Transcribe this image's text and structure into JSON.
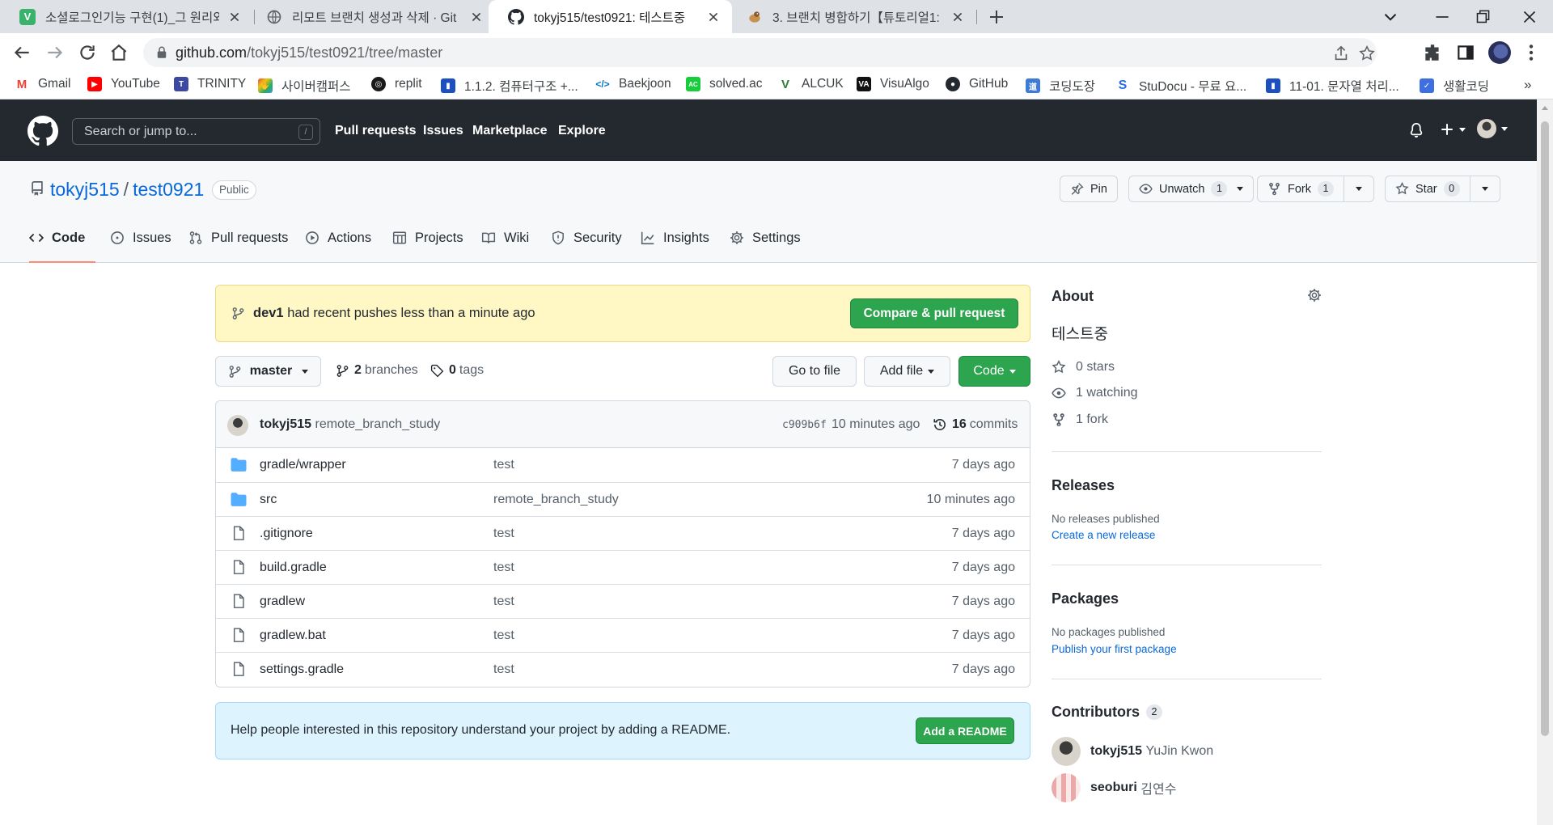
{
  "browser": {
    "tabs": [
      {
        "title": "소셜로그인기능 구현(1)_그 원리와",
        "favicon": "v-icon"
      },
      {
        "title": "리모트 브랜치 생성과 삭제 · Git",
        "favicon": "globe-icon"
      },
      {
        "title": "tokyj515/test0921: 테스트중",
        "favicon": "github-icon"
      },
      {
        "title": "3. 브랜치 병합하기【튜토리얼1:",
        "favicon": "bird-icon"
      }
    ],
    "url": {
      "host": "github.com",
      "path": "/tokyj515/test0921/tree/master"
    },
    "bookmarks": [
      {
        "label": "Gmail",
        "icon": "gmail-icon",
        "color": "#ea4335"
      },
      {
        "label": "YouTube",
        "icon": "youtube-icon",
        "color": "#ff0000"
      },
      {
        "label": "TRINITY",
        "icon": "trinity-icon",
        "color": "#3b4aa0"
      },
      {
        "label": "사이버캠퍼스",
        "icon": "hand-icon",
        "color": "#8e44ad"
      },
      {
        "label": "replit",
        "icon": "replit-icon",
        "color": "#1a1a1a"
      },
      {
        "label": "1.1.2. 컴퓨터구조 +...",
        "icon": "book-icon",
        "color": "#1c4fbf"
      },
      {
        "label": "Baekjoon",
        "icon": "code-icon",
        "color": "#0076c0"
      },
      {
        "label": "solved.ac",
        "icon": "solvedac-icon",
        "color": "#17ce3a"
      },
      {
        "label": "ALCUK",
        "icon": "alcuk-icon",
        "color": "#2e7d32"
      },
      {
        "label": "VisuAlgo",
        "icon": "visualgo-icon",
        "color": "#111111"
      },
      {
        "label": "GitHub",
        "icon": "github-icon",
        "color": "#24292f"
      },
      {
        "label": "코딩도장",
        "icon": "dojang-icon",
        "color": "#3f7bd6"
      },
      {
        "label": "StuDocu - 무료 요...",
        "icon": "studocu-icon",
        "color": "#2b6be6"
      },
      {
        "label": "11-01. 문자열 처리...",
        "icon": "book-icon",
        "color": "#1c4fbf"
      },
      {
        "label": "생활코딩",
        "icon": "shield-icon",
        "color": "#3d6fe0"
      }
    ],
    "bookmarks_more": "»"
  },
  "gh": {
    "search_placeholder": "Search or jump to...",
    "search_key": "/",
    "nav": [
      "Pull requests",
      "Issues",
      "Marketplace",
      "Explore"
    ]
  },
  "repo": {
    "owner": "tokyj515",
    "slash": "/",
    "name": "test0921",
    "visibility": "Public",
    "pin": "Pin",
    "unwatch": "Unwatch",
    "watch_count": "1",
    "fork": "Fork",
    "fork_count": "1",
    "star": "Star",
    "star_count": "0",
    "tabs": [
      {
        "label": "Code",
        "icon": "code-icon",
        "selected": true
      },
      {
        "label": "Issues",
        "icon": "issue-icon"
      },
      {
        "label": "Pull requests",
        "icon": "pull-request-icon"
      },
      {
        "label": "Actions",
        "icon": "play-icon"
      },
      {
        "label": "Projects",
        "icon": "table-icon"
      },
      {
        "label": "Wiki",
        "icon": "book-icon"
      },
      {
        "label": "Security",
        "icon": "shield-icon"
      },
      {
        "label": "Insights",
        "icon": "graph-icon"
      },
      {
        "label": "Settings",
        "icon": "gear-icon"
      }
    ]
  },
  "banner": {
    "branch": "dev1",
    "text": "had recent pushes less than a minute ago",
    "button": "Compare & pull request"
  },
  "bar": {
    "branch": "master",
    "branches_count": "2",
    "branches_label": "branches",
    "tags_count": "0",
    "tags_label": "tags",
    "go_to_file": "Go to file",
    "add_file": "Add file",
    "code": "Code"
  },
  "commit": {
    "author": "tokyj515",
    "message": "remote_branch_study",
    "sha": "c909b6f",
    "time": "10 minutes ago",
    "count": "16",
    "count_label": "commits"
  },
  "files": [
    {
      "name": "gradle/wrapper",
      "type": "dir",
      "message": "test",
      "age": "7 days ago"
    },
    {
      "name": "src",
      "type": "dir",
      "message": "remote_branch_study",
      "age": "10 minutes ago"
    },
    {
      "name": ".gitignore",
      "type": "file",
      "message": "test",
      "age": "7 days ago"
    },
    {
      "name": "build.gradle",
      "type": "file",
      "message": "test",
      "age": "7 days ago"
    },
    {
      "name": "gradlew",
      "type": "file",
      "message": "test",
      "age": "7 days ago"
    },
    {
      "name": "gradlew.bat",
      "type": "file",
      "message": "test",
      "age": "7 days ago"
    },
    {
      "name": "settings.gradle",
      "type": "file",
      "message": "test",
      "age": "7 days ago"
    }
  ],
  "readme": {
    "text": "Help people interested in this repository understand your project by adding a README.",
    "button": "Add a README"
  },
  "about": {
    "title": "About",
    "description": "테스트중",
    "stars": "0 stars",
    "watching": "1 watching",
    "forks": "1 fork"
  },
  "releases": {
    "title": "Releases",
    "empty": "No releases published",
    "link": "Create a new release"
  },
  "packages": {
    "title": "Packages",
    "empty": "No packages published",
    "link": "Publish your first package"
  },
  "contributors": {
    "title": "Contributors",
    "count": "2",
    "list": [
      {
        "login": "tokyj515",
        "name": "YuJin Kwon"
      },
      {
        "login": "seoburi",
        "name": "김연수"
      }
    ]
  },
  "colors": {
    "accent": "#0969da",
    "green": "#2da44e",
    "header": "#24292f",
    "tab_underline": "#fd8c73"
  }
}
